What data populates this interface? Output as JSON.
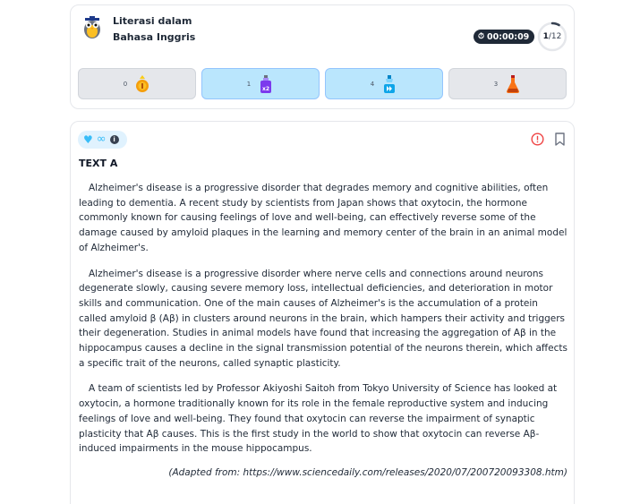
{
  "header": {
    "subject": "Literasi dalam Bahasa Inggris",
    "timer": "00:00:09",
    "progress_current": "1",
    "progress_total": "/12",
    "progress_fraction": 0.0833
  },
  "boosters": [
    {
      "count": "0",
      "icon": "coin-icon",
      "style": "gray"
    },
    {
      "count": "1",
      "icon": "potion-x2-icon",
      "style": "blue"
    },
    {
      "count": "4",
      "icon": "potion-skip-icon",
      "style": "blue"
    },
    {
      "count": "3",
      "icon": "flask-icon",
      "style": "gray"
    }
  ],
  "content": {
    "lives_symbol": "∞",
    "info_symbol": "i",
    "title": "TEXT A",
    "paragraphs": [
      "Alzheimer's disease is a progressive disorder that degrades memory and cognitive abilities, often leading to dementia. A recent study by scientists from Japan shows that oxytocin, the hormone commonly known for causing feelings of love and well-being, can effectively reverse some of the damage caused by amyloid plaques in the learning and memory center of the brain in an animal model of Alzheimer's.",
      "Alzheimer's disease is a progressive disorder where nerve cells and connections around neurons degenerate slowly, causing severe memory loss, intellectual deficiencies, and deterioration in motor skills and communication. One of the main causes of Alzheimer's is the accumulation of a protein called amyloid β (Aβ) in clusters around neurons in the brain, which hampers their activity and triggers their degeneration. Studies in animal models have found that increasing the aggregation of Aβ in the hippocampus causes a decline in the signal transmission potential of the neurons therein, which affects a specific trait of the neurons, called synaptic plasticity.",
      "A team of scientists led by Professor Akiyoshi Saitoh from Tokyo University of Science has looked at oxytocin, a hormone traditionally known for its role in the female reproductive system and inducing feelings of love and well-being. They found that oxytocin can reverse the impairment of synaptic plasticity that Aβ causes. This is the first study in the world to show that oxytocin can reverse Aβ-induced impairments in the mouse hippocampus."
    ],
    "source": "(Adapted from: https://www.sciencedaily.com/releases/2020/07/200720093308.htm)"
  },
  "colors": {
    "accent_blue": "#38bdf8",
    "booster_blue": "#bae6fd",
    "booster_gray": "#e5e7eb",
    "timer_bg": "#1f2937",
    "report_red": "#ef4444"
  }
}
